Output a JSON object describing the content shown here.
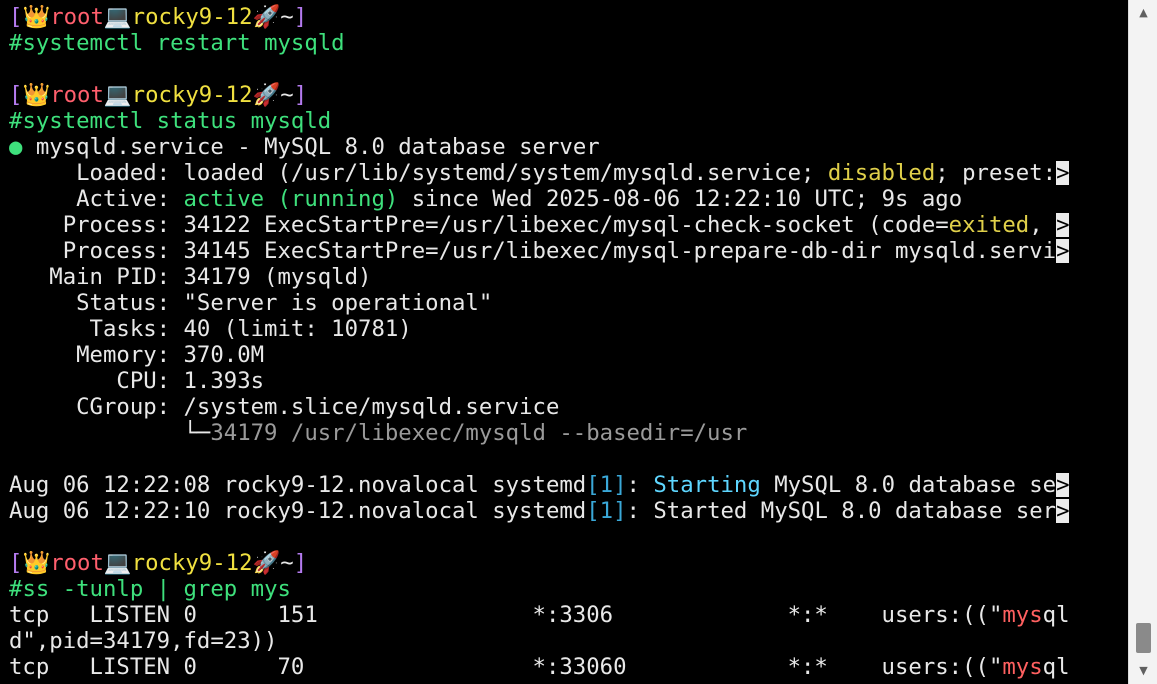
{
  "prompt": {
    "bracket_open": "[",
    "user_icon": "👑",
    "user": "root",
    "host_icon": "💻",
    "host": "rocky9-12",
    "path_icon": "🚀",
    "path": "~",
    "bracket_close": "]",
    "symbol": "#"
  },
  "commands": {
    "c1": "systemctl restart mysqld",
    "c2": "systemctl status mysqld",
    "c3": "ss -tunlp | grep mys"
  },
  "status": {
    "dot": "●",
    "unit_line": " mysqld.service - MySQL 8.0 database server",
    "loaded_pre": "     Loaded: loaded (/usr/lib/systemd/system/mysqld.service; ",
    "loaded_disabled": "disabled",
    "loaded_post": "; preset:",
    "active_pre": "     Active: ",
    "active_state": "active (running)",
    "active_post": " since Wed 2025-08-06 12:22:10 UTC; 9s ago",
    "process1_pre": "    Process: 34122 ExecStartPre=/usr/libexec/mysql-check-socket (code=",
    "process1_exited": "exited",
    "process1_post": ", ",
    "process2": "    Process: 34145 ExecStartPre=/usr/libexec/mysql-prepare-db-dir mysqld.servi",
    "main_pid": "   Main PID: 34179 (mysqld)",
    "status_line": "     Status: \"Server is operational\"",
    "tasks": "      Tasks: 40 (limit: 10781)",
    "memory": "     Memory: 370.0M",
    "cpu": "        CPU: 1.393s",
    "cgroup": "     CGroup: /system.slice/mysqld.service",
    "cgroup_tree": "             └─",
    "cgroup_proc": "34179 /usr/libexec/mysqld --basedir=/usr"
  },
  "truncation_marker": ">",
  "logs": [
    {
      "pre": "Aug 06 12:22:08 rocky9-12.novalocal systemd",
      "pid": "[1]",
      "colon": ": ",
      "verb": "Starting",
      "rest": " MySQL 8.0 database se"
    },
    {
      "pre": "Aug 06 12:22:10 rocky9-12.novalocal systemd",
      "pid": "[1]",
      "colon": ": ",
      "verb": "Started",
      "rest": " MySQL 8.0 database ser"
    }
  ],
  "sockets": [
    {
      "pre": "tcp   LISTEN 0      151                *:3306             *:*    users:((\"",
      "match": "mys",
      "post": "ql"
    },
    {
      "wrap": "d\",pid=34179,fd=23))"
    },
    {
      "pre": "tcp   LISTEN 0      70                 *:33060            *:*    users:((\"",
      "match": "mys",
      "post": "ql"
    }
  ],
  "colors": {
    "background": "#000000",
    "foreground": "#e8e8e8",
    "bracket": "#b57bf0",
    "user": "#ff5f6d",
    "host": "#f0e040",
    "command": "#3ee07c",
    "active": "#3ee07c",
    "disabled": "#e0d04a",
    "exited": "#e0d04a",
    "grep_match": "#ff6060",
    "systemd_pid": "#3aa8d8",
    "starting": "#5ed6ff"
  },
  "scrollbar": {
    "up_icon": "▲",
    "down_icon": "▼"
  }
}
